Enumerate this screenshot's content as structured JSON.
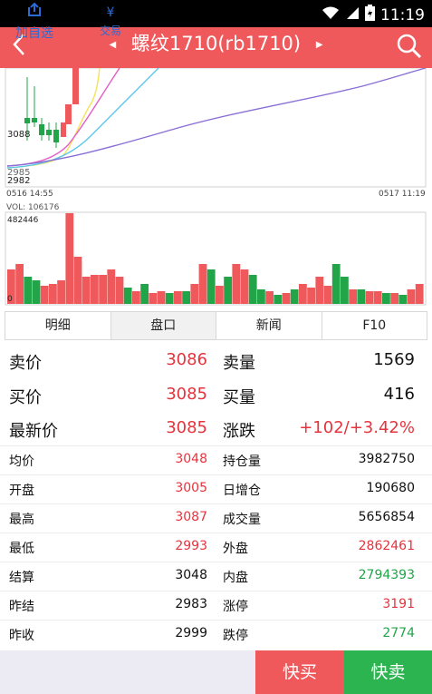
{
  "status": {
    "time": "11:19"
  },
  "header": {
    "title": "螺纹1710(rb1710)"
  },
  "chart": {
    "price_labels": [
      "3088",
      "2985",
      "2982"
    ],
    "time_start": "0516 14:55",
    "time_end": "0517 11:19",
    "vol_label": "VOL: 106176",
    "vol_max": "482446",
    "vol_zero": "0"
  },
  "tabs": [
    "明细",
    "盘口",
    "新闻",
    "F10"
  ],
  "quote": {
    "sell_price_label": "卖价",
    "sell_price": "3086",
    "sell_vol_label": "卖量",
    "sell_vol": "1569",
    "buy_price_label": "买价",
    "buy_price": "3085",
    "buy_vol_label": "买量",
    "buy_vol": "416",
    "last_label": "最新价",
    "last": "3085",
    "change_label": "涨跌",
    "change": "+102/+3.42%"
  },
  "rows": [
    {
      "l1": "均价",
      "v1": "3048",
      "l2": "持仓量",
      "v2": "3982750"
    },
    {
      "l1": "开盘",
      "v1": "3005",
      "l2": "日增仓",
      "v2": "190680"
    },
    {
      "l1": "最高",
      "v1": "3087",
      "l2": "成交量",
      "v2": "5656854"
    },
    {
      "l1": "最低",
      "v1": "2993",
      "l2": "外盘",
      "v2": "2862461"
    },
    {
      "l1": "结算",
      "v1": "3048",
      "l2": "内盘",
      "v2": "2794393"
    },
    {
      "l1": "昨结",
      "v1": "2983",
      "l2": "涨停",
      "v2": "3191"
    },
    {
      "l1": "昨收",
      "v1": "2999",
      "l2": "跌停",
      "v2": "2774"
    }
  ],
  "bottom": {
    "add_watch_label": "加自选",
    "trade_label": "交易",
    "trade_icon": "¥",
    "quick_buy_label": "快买",
    "quick_sell_label": "快卖"
  },
  "colors": {
    "header": "#f0595c",
    "up": "#e5343d",
    "down": "#21a548",
    "sell_btn": "#2cb450"
  }
}
